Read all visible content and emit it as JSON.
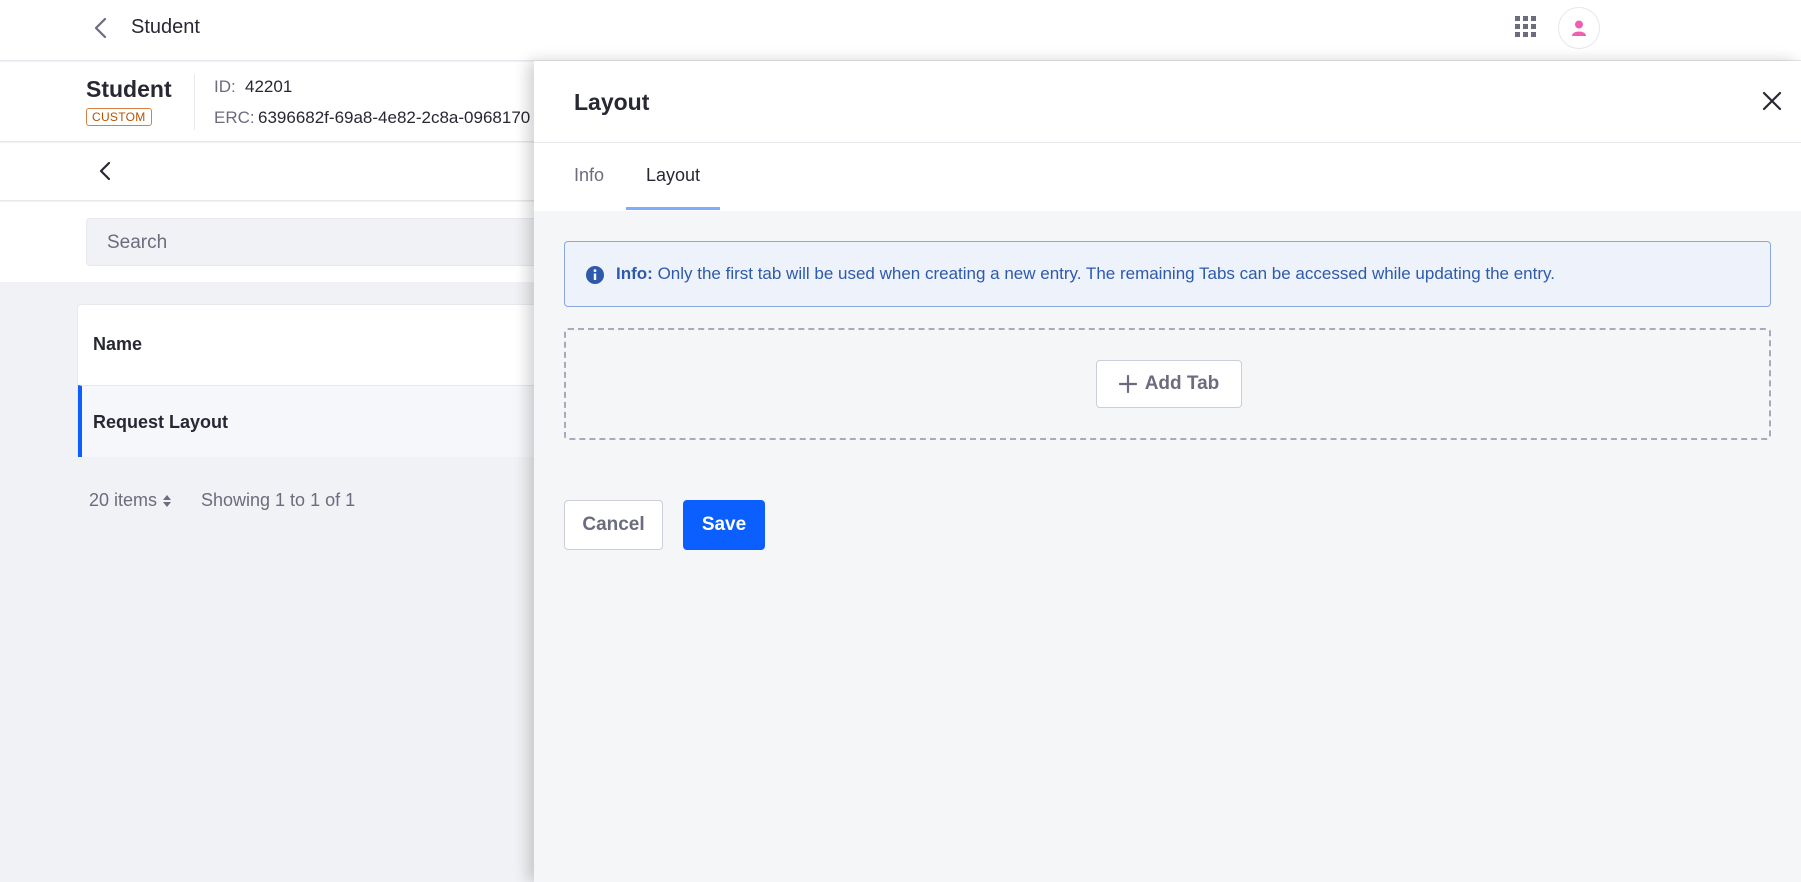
{
  "topbar": {
    "title": "Student",
    "back_icon": "chevron-left-icon",
    "apps_icon": "apps-grid-icon",
    "avatar_icon": "user-icon"
  },
  "object": {
    "name": "Student",
    "badge": "CUSTOM",
    "id_label": "ID:",
    "id_value": "42201",
    "erc_label": "ERC:",
    "erc_value": "6396682f-69a8-4e82-2c8a-0968170"
  },
  "search": {
    "placeholder": "Search"
  },
  "table": {
    "header": "Name",
    "rows": [
      "Request Layout"
    ]
  },
  "pager": {
    "items_per_page": "20 items",
    "showing": "Showing 1 to 1 of 1"
  },
  "panel": {
    "title": "Layout",
    "tabs": [
      {
        "label": "Info",
        "active": false
      },
      {
        "label": "Layout",
        "active": true
      }
    ],
    "alert": {
      "prefix": "Info:",
      "message": "Only the first tab will be used when creating a new entry. The remaining Tabs can be accessed while updating the entry."
    },
    "add_tab_label": "Add Tab",
    "cancel_label": "Cancel",
    "save_label": "Save"
  },
  "colors": {
    "primary": "#0b5fff",
    "info_text": "#2e5aac",
    "badge": "#b95000",
    "avatar_pink": "#f05fb5"
  }
}
